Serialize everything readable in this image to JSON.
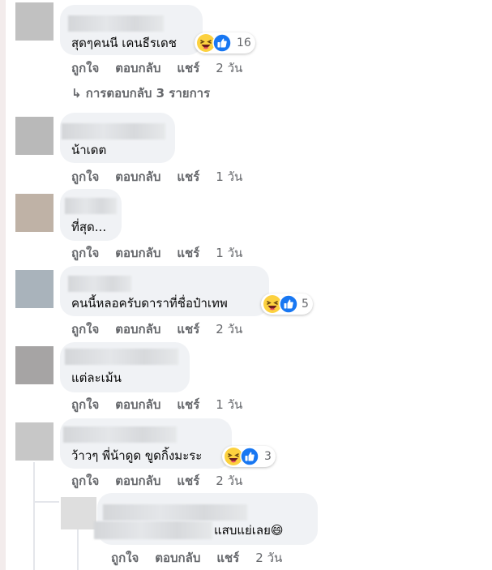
{
  "actions": {
    "like": "ถูกใจ",
    "reply": "ตอบกลับ",
    "share": "แชร์"
  },
  "colors": {
    "like_blue": "#1877f2",
    "haha_yellow": "#fcd13f",
    "text_secondary": "#65676b",
    "bubble_bg": "#f0f2f5"
  },
  "comments": [
    {
      "text": "สุดๆคนนี เคนธีรเดช",
      "age": "2 วัน",
      "reactions": {
        "icons": [
          "haha-icon",
          "like-icon"
        ],
        "count": "16"
      }
    },
    {
      "text": "น้าเดต",
      "age": "1 วัน"
    },
    {
      "text": "ที่สุด...",
      "age": "1 วัน"
    },
    {
      "text": "คนนี้หลอครับดาราที่ชื่อป๋าเทพ",
      "age": "2 วัน",
      "reactions": {
        "icons": [
          "haha-icon",
          "like-icon"
        ],
        "count": "5"
      }
    },
    {
      "text": "แต่ละเม้น",
      "age": "1 วัน"
    },
    {
      "text": "ว้าวๆ พี่น้าดูด ขูดกิ้งมะระ",
      "age": "2 วัน",
      "reactions": {
        "icons": [
          "haha-icon",
          "like-icon"
        ],
        "count": "3"
      }
    }
  ],
  "replies_link": "↳ การตอบกลับ 3 รายการ",
  "nested_reply": {
    "text": "แสบแย่เลย😄",
    "age": "2 วัน"
  }
}
